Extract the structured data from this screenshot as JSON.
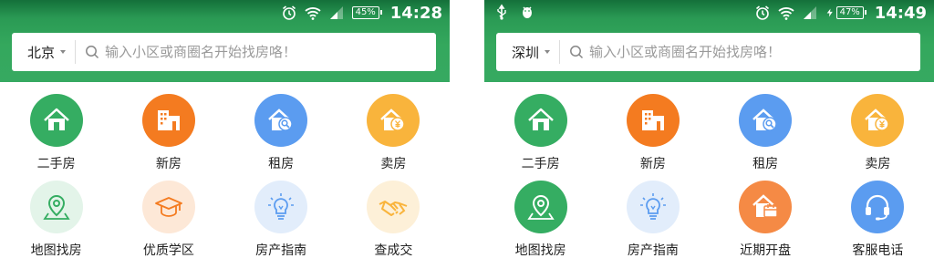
{
  "colors": {
    "header_green": "#34a85d",
    "green": "#35ad62",
    "orange": "#f47b20",
    "blue": "#5b9cf0",
    "yellow": "#f9b43c",
    "light_green_bg": "#e3f4e9",
    "light_orange_bg": "#fde8d7",
    "light_blue_bg": "#e2edfb",
    "light_yellow_bg": "#fdf0d8"
  },
  "left": {
    "status": {
      "time": "14:28",
      "battery": "45%"
    },
    "search": {
      "city": "北京",
      "placeholder": "输入小区或商圈名开始找房咯！"
    },
    "grid": [
      {
        "label": "二手房",
        "icon": "house-icon"
      },
      {
        "label": "新房",
        "icon": "building-icon"
      },
      {
        "label": "租房",
        "icon": "house-key-icon"
      },
      {
        "label": "卖房",
        "icon": "house-yen-icon"
      },
      {
        "label": "地图找房",
        "icon": "map-pin-icon"
      },
      {
        "label": "优质学区",
        "icon": "graduation-cap-icon"
      },
      {
        "label": "房产指南",
        "icon": "lightbulb-icon"
      },
      {
        "label": "查成交",
        "icon": "handshake-icon"
      }
    ]
  },
  "right": {
    "status": {
      "time": "14:49",
      "battery": "47%"
    },
    "search": {
      "city": "深圳",
      "placeholder": "输入小区或商圈名开始找房咯！"
    },
    "grid": [
      {
        "label": "二手房",
        "icon": "house-icon"
      },
      {
        "label": "新房",
        "icon": "building-icon"
      },
      {
        "label": "租房",
        "icon": "house-key-icon"
      },
      {
        "label": "卖房",
        "icon": "house-yen-icon"
      },
      {
        "label": "地图找房",
        "icon": "map-pin-icon"
      },
      {
        "label": "房产指南",
        "icon": "lightbulb-icon"
      },
      {
        "label": "近期开盘",
        "icon": "house-calendar-icon"
      },
      {
        "label": "客服电话",
        "icon": "headset-icon"
      }
    ]
  }
}
